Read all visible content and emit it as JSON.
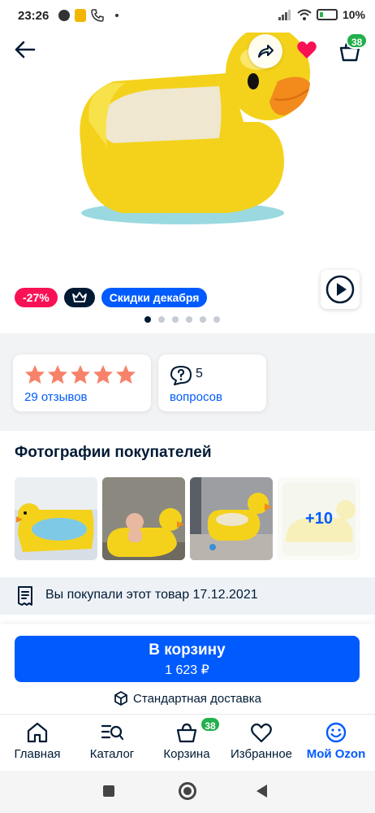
{
  "status_bar": {
    "time": "23:26",
    "battery": "10%"
  },
  "product": {
    "badges": {
      "discount": "-27%",
      "sale": "Скидки декабря"
    },
    "gallery": {
      "total_dots": 6,
      "active_index": 0
    }
  },
  "rating": {
    "stars": 5,
    "reviews_label": "29 отзывов"
  },
  "questions": {
    "count": "5",
    "label": "вопросов"
  },
  "photos": {
    "title": "Фотографии покупателей",
    "more_label": "+10"
  },
  "purchase_note": "Вы покупали этот товар 17.12.2021",
  "cart_button": {
    "label": "В корзину",
    "price": "1 623 ₽"
  },
  "delivery": "Стандартная доставка",
  "top_bar": {
    "cart_badge": "38"
  },
  "nav": {
    "items": [
      {
        "label": "Главная",
        "icon": "home-icon"
      },
      {
        "label": "Каталог",
        "icon": "catalog-search-icon"
      },
      {
        "label": "Корзина",
        "icon": "basket-icon"
      },
      {
        "label": "Избранное",
        "icon": "heart-icon"
      },
      {
        "label": "Мой Ozon",
        "icon": "smile-icon"
      }
    ],
    "cart_badge": "38"
  },
  "colors": {
    "accent": "#005bff",
    "discount": "#f91155",
    "badge_green": "#21b04b",
    "star": "#f7826a",
    "text": "#001a34"
  }
}
